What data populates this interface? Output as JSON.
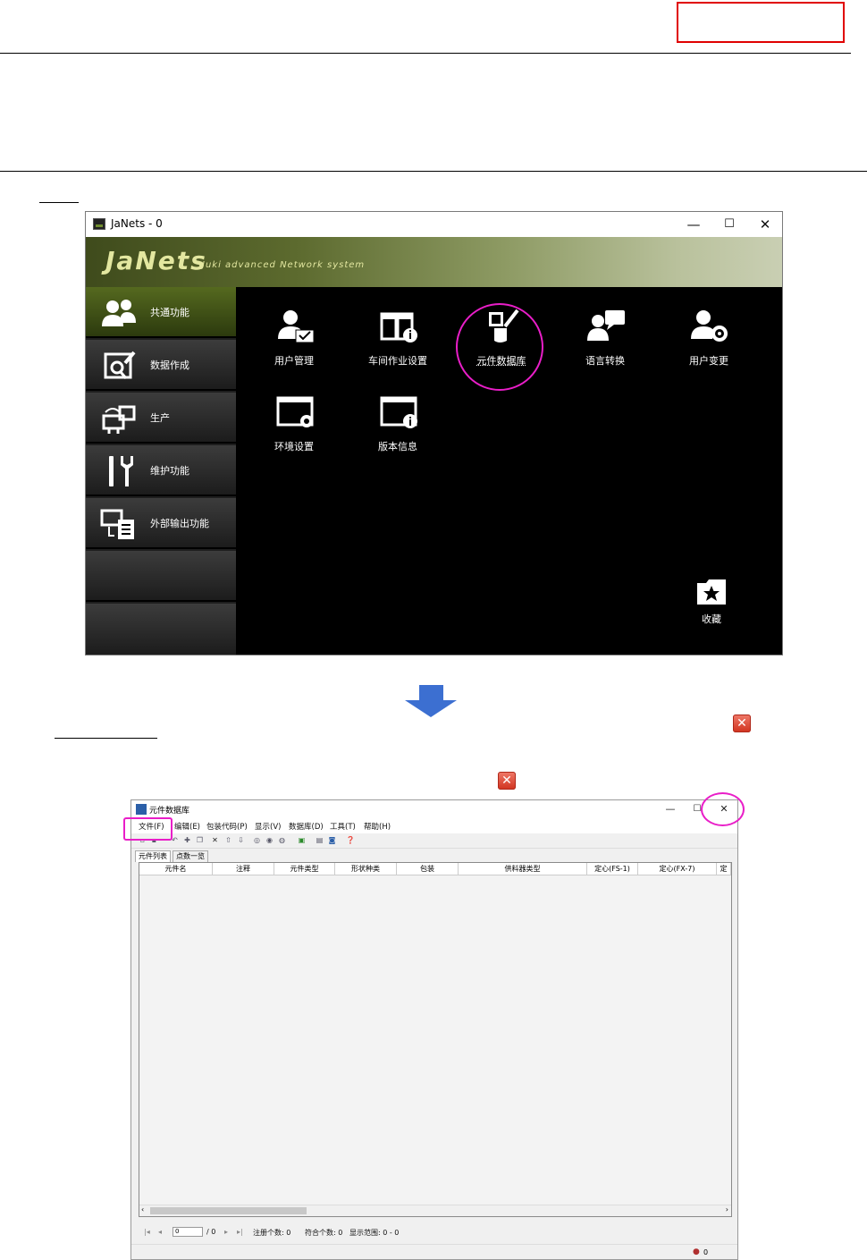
{
  "janets": {
    "title": "JaNets - 0",
    "logo": "JaNets",
    "tagline": "Juki advanced Network system",
    "controls": {
      "minimize": "—",
      "maximize": "☐",
      "close": "✕"
    },
    "sidebar": [
      {
        "label": "共通功能",
        "icon": "users-icon",
        "active": true
      },
      {
        "label": "数据作成",
        "icon": "data-create-icon"
      },
      {
        "label": "生产",
        "icon": "production-icon"
      },
      {
        "label": "维护功能",
        "icon": "maintenance-tools-icon"
      },
      {
        "label": "外部输出功能",
        "icon": "external-output-icon"
      },
      {
        "label": ""
      },
      {
        "label": ""
      }
    ],
    "tiles": [
      {
        "label": "用户管理",
        "icon": "user-management-icon"
      },
      {
        "label": "车间作业设置",
        "icon": "workshop-settings-icon"
      },
      {
        "label": "元件数据库",
        "icon": "parts-database-icon"
      },
      {
        "label": "语言转换",
        "icon": "language-icon"
      },
      {
        "label": "用户变更",
        "icon": "user-change-icon"
      },
      {
        "label": "环境设置",
        "icon": "environment-settings-icon"
      },
      {
        "label": "版本信息",
        "icon": "version-info-icon"
      },
      {
        "label": "收藏",
        "icon": "favorites-folder-icon"
      }
    ]
  },
  "partsdb": {
    "title": "元件数据库",
    "controls": {
      "minimize": "—",
      "maximize": "☐",
      "close": "✕"
    },
    "menu": [
      "文件(F)",
      "编辑(E)",
      "包装代码(P)",
      "显示(V)",
      "数据库(D)",
      "工具(T)",
      "帮助(H)"
    ],
    "tabs": [
      "元件列表",
      "点数一览"
    ],
    "columns": [
      "元件名",
      "注释",
      "元件类型",
      "形状种类",
      "包装",
      "供料器类型",
      "定心(FS-1)",
      "定心(FX-7)",
      "定"
    ],
    "nav": {
      "page_value": "0",
      "page_total": "/ 0",
      "registered": "注册个数: 0",
      "matched": "符合个数: 0",
      "range": "显示范围: 0 - 0"
    },
    "status": {
      "user_count": "0"
    }
  }
}
